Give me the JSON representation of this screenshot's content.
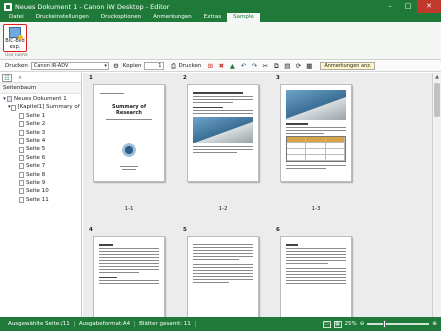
{
  "window": {
    "title": "Neues Dokument 1 - Canon iW Desktop - Editor",
    "min_label": "–",
    "max_label": "□",
    "close_label": "✕"
  },
  "tabs": [
    "Datei",
    "Druckeinstellungen",
    "Druckoptionen",
    "Anmerkungen",
    "Extras",
    "Sample"
  ],
  "active_tab": "Sample",
  "ribbon": {
    "button_label": "BIC-Bild exp.",
    "group_label": "Use name"
  },
  "toolbar": {
    "print_label": "Drucken",
    "printer_value": "Canon iR-ADV",
    "copies_label": "Kopien",
    "copies_value": "1",
    "print_button_label": "Drucken",
    "annotations_label": "Anmerkungen anz."
  },
  "left_pane": {
    "header": "Seitenbaum",
    "tree": [
      {
        "label": "Neues Dokument 1",
        "level": 0
      },
      {
        "label": "[Kapitel1] Summary of Re",
        "level": 1
      },
      {
        "label": "Seite 1",
        "level": 2
      },
      {
        "label": "Seite 2",
        "level": 2
      },
      {
        "label": "Seite 3",
        "level": 2
      },
      {
        "label": "Seite 4",
        "level": 2
      },
      {
        "label": "Seite 5",
        "level": 2
      },
      {
        "label": "Seite 6",
        "level": 2
      },
      {
        "label": "Seite 7",
        "level": 2
      },
      {
        "label": "Seite 8",
        "level": 2
      },
      {
        "label": "Seite 9",
        "level": 2
      },
      {
        "label": "Seite 10",
        "level": 2
      },
      {
        "label": "Seite 11",
        "level": 2
      }
    ]
  },
  "pages": [
    {
      "number": "1",
      "label": "1-1",
      "heading": "Summary of Research"
    },
    {
      "number": "2",
      "label": "1-2",
      "heading": ""
    },
    {
      "number": "3",
      "label": "1-3",
      "heading": ""
    },
    {
      "number": "4",
      "label": "",
      "heading": ""
    },
    {
      "number": "5",
      "label": "",
      "heading": ""
    },
    {
      "number": "6",
      "label": "",
      "heading": ""
    }
  ],
  "status": {
    "selected_pages": "Ausgewählte Seite:/11",
    "output_format": "Ausgabeformat:A4",
    "sheets_total": "Blätter gesamt: 11",
    "zoom": "25%"
  },
  "colors": {
    "accent": "#1f7a3a",
    "highlight": "#e0201a"
  }
}
